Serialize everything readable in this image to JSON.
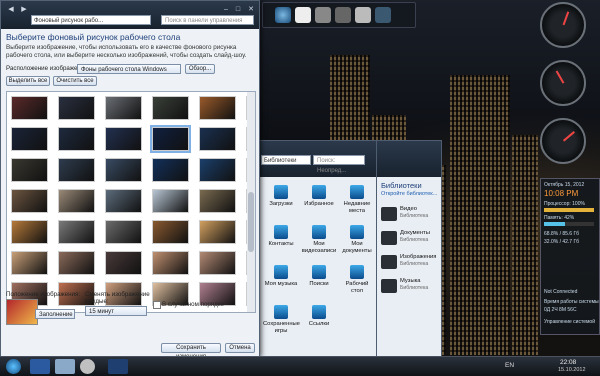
{
  "main_window": {
    "address": "Фоновый рисунок рабо...",
    "search_placeholder": "Поиск в панели управления",
    "heading": "Выберите фоновый рисунок рабочего стола",
    "subtitle": "Выберите изображение, чтобы использовать его в качестве фонового рисунка рабочего стола, или выберите несколько изображений, чтобы создать слайд-шоу.",
    "location_label": "Расположение изображения:",
    "location_value": "Фоны рабочего стола Windows",
    "browse_button": "Обзор...",
    "select_all_button": "Выделить все",
    "clear_all_button": "Очистить все",
    "position_label": "Положение изображения:",
    "position_value": "Заполнение",
    "change_every_label": "Сменять изображение каждые:",
    "interval_value": "15 минут",
    "shuffle_label": "В случайном порядке",
    "save_button": "Сохранить изменения",
    "cancel_button": "Отмена"
  },
  "thumb_colors": [
    "#5b2a2a",
    "#2a3040",
    "#6a6e74",
    "#3a4038",
    "#9a5a2a",
    "#2a3a5a",
    "#1a2438",
    "#1e2a3e",
    "#223050",
    "#102040",
    "#1a3050",
    "#2a2418",
    "#3a3830",
    "#2e3c4e",
    "#394b63",
    "#12305a",
    "#1b3f6b",
    "#3a2a1a",
    "#6c5540",
    "#9a8a78",
    "#5c6c7c",
    "#b8c6d4",
    "#7a6a50",
    "#caa24a",
    "#b67a3a",
    "#7a7a7a",
    "#6b6b6b",
    "#8a5a30",
    "#d2a060",
    "#5b3b2b",
    "#c8a078",
    "#8a6a5a",
    "#4a3a3a",
    "#c09070",
    "#b38a74",
    "#8d6d5d",
    "#a07060",
    "#c07050",
    "#d0a080",
    "#e0c0a0",
    "#b08090",
    "#9a7a6a"
  ],
  "selected_thumb_index": 9,
  "explorer1": {
    "breadcrumb": "Библиотеки",
    "search": "Поиск: Неопред...",
    "items": [
      "Загрузки",
      "Избранное",
      "Недавние места",
      "Контакты",
      "Мои видеозаписи",
      "Мои документы",
      "Моя музыка",
      "Поиски",
      "Рабочий стол",
      "Сохраненные игры",
      "Ссылки"
    ]
  },
  "explorer2": {
    "title": "Библиотеки",
    "subtitle": "Откройте библиотек...",
    "rows": [
      {
        "name": "Видео",
        "type": "Библиотека"
      },
      {
        "name": "Документы",
        "type": "Библиотека"
      },
      {
        "name": "Изображения",
        "type": "Библиотека"
      },
      {
        "name": "Музыка",
        "type": "Библиотека"
      }
    ]
  },
  "sysmon": {
    "date": "Октябрь 15, 2012",
    "time": "10:08 PM",
    "cpu_label": "Процессор: 100%",
    "cpu_percent": 100,
    "ram_label": "Память: 42%",
    "ram_percent": 42,
    "disk1": "68.8% / 85.6 Гб",
    "disk2": "32.0% / 42.7 Гб",
    "net": "Not Connected",
    "uptime_label": "Время работы системы",
    "uptime": "0Д 2Ч 8М 56С",
    "manage": "Управление системой"
  },
  "taskbar": {
    "lang": "EN",
    "clock_time": "22:08",
    "clock_date": "15.10.2012"
  }
}
